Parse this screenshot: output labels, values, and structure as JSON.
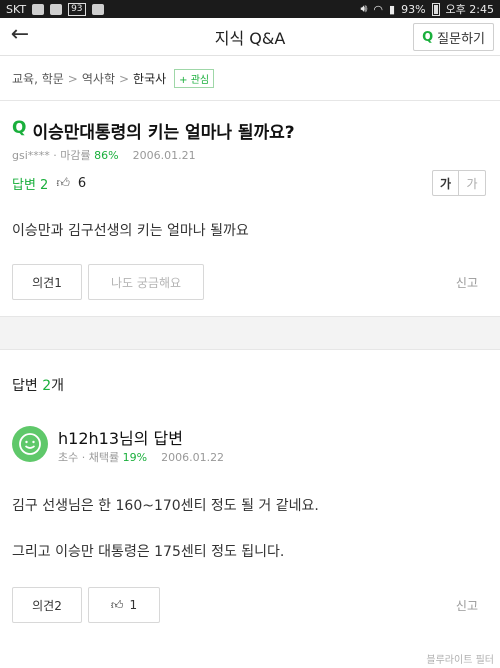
{
  "status_bar": {
    "carrier": "SKT",
    "badge": "93",
    "battery": "93%",
    "time": "오후 2:45"
  },
  "header": {
    "back_icon": "back-arrow-icon",
    "title": "지식 Q&A",
    "ask_button_q": "Q",
    "ask_button_label": "질문하기"
  },
  "breadcrumb": {
    "items": [
      "교육, 학문",
      "역사학",
      "한국사"
    ],
    "separator": ">",
    "interest_label": "+ 관심"
  },
  "question": {
    "q_mark": "Q",
    "title": "이승만대통령의 키는 얼마나 될까요?",
    "author": "gsi****",
    "close_rate_label": "마감률",
    "close_rate": "86%",
    "date": "2006.01.21",
    "answers_label": "답변 2",
    "likes": "6",
    "fontsize_large": "가",
    "fontsize_small": "가",
    "body": "이승만과 김구선생의 키는 얼마나 될까요",
    "opinion_button": "의견1",
    "curious_button": "나도 궁금해요",
    "report": "신고"
  },
  "answers": {
    "count_prefix": "답변 ",
    "count": "2",
    "count_suffix": "개",
    "list": [
      {
        "user": "h12h13님의 답변",
        "rank": "초수",
        "adopt_label": "채택률",
        "adopt_rate": "19%",
        "date": "2006.01.22",
        "line1": "김구 선생님은 한 160~170센티 정도 될 거 같네요.",
        "line2": "그리고 이승만 대통령은 175센티 정도 됩니다.",
        "opinion_button": "의견2",
        "likes": "1",
        "report": "신고"
      }
    ]
  },
  "watermark": "블루라이트 필터",
  "colors": {
    "accent": "#1aaf3c",
    "avatar": "#5fc86a",
    "status_bar": "#1b1b1b"
  }
}
